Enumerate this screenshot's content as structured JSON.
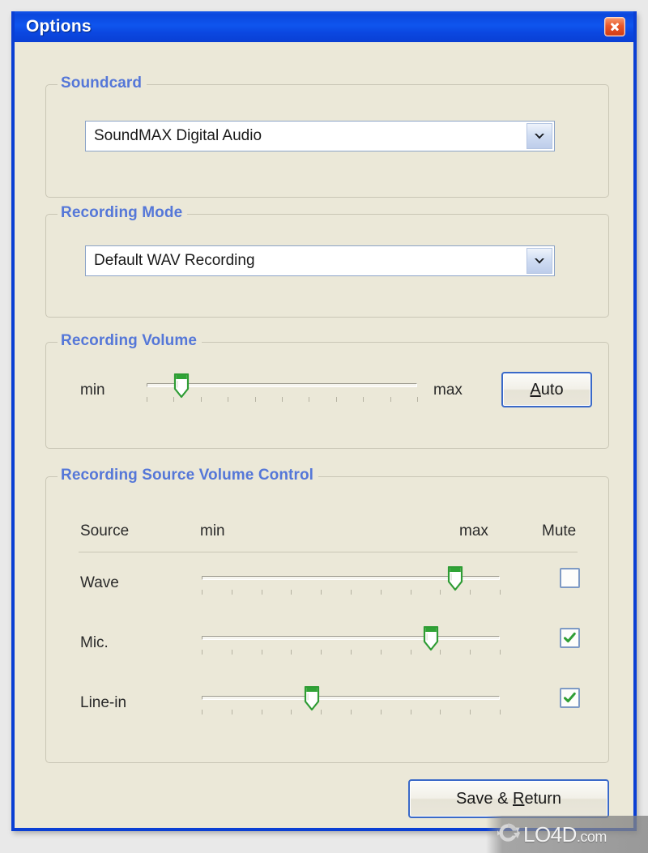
{
  "window": {
    "title": "Options",
    "close_icon": "close-icon",
    "accent_titlebar": "#0a47dd",
    "background": "#ebe8d8",
    "legend_color": "#5577d8"
  },
  "groups": {
    "soundcard": {
      "legend": "Soundcard",
      "combo": {
        "value": "SoundMAX Digital Audio",
        "arrow_icon": "chevron-down-icon"
      }
    },
    "recording_mode": {
      "legend": "Recording Mode",
      "combo": {
        "value": "Default WAV Recording",
        "arrow_icon": "chevron-down-icon"
      }
    },
    "recording_volume": {
      "legend": "Recording Volume",
      "min_label": "min",
      "max_label": "max",
      "auto_button": {
        "prefix": "",
        "accel": "A",
        "suffix": "uto",
        "full_label": "Auto"
      },
      "slider": {
        "value_percent": 13,
        "tick_count": 11
      }
    },
    "recording_source": {
      "legend": "Recording Source Volume Control",
      "headers": {
        "source": "Source",
        "min": "min",
        "max": "max",
        "mute": "Mute"
      },
      "rows": [
        {
          "label": "Wave",
          "value_percent": 85,
          "muted": false,
          "tick_count": 11
        },
        {
          "label": "Mic.",
          "value_percent": 77,
          "muted": true,
          "tick_count": 11
        },
        {
          "label": "Line-in",
          "value_percent": 37,
          "muted": true,
          "tick_count": 11
        }
      ]
    }
  },
  "footer": {
    "save_button": {
      "prefix": "Save & ",
      "accel": "R",
      "suffix": "eturn",
      "full_label": "Save & Return"
    }
  },
  "watermark": {
    "name": "LO4D",
    "suffix": ".com",
    "logo_icon": "refresh-circle-icon"
  }
}
